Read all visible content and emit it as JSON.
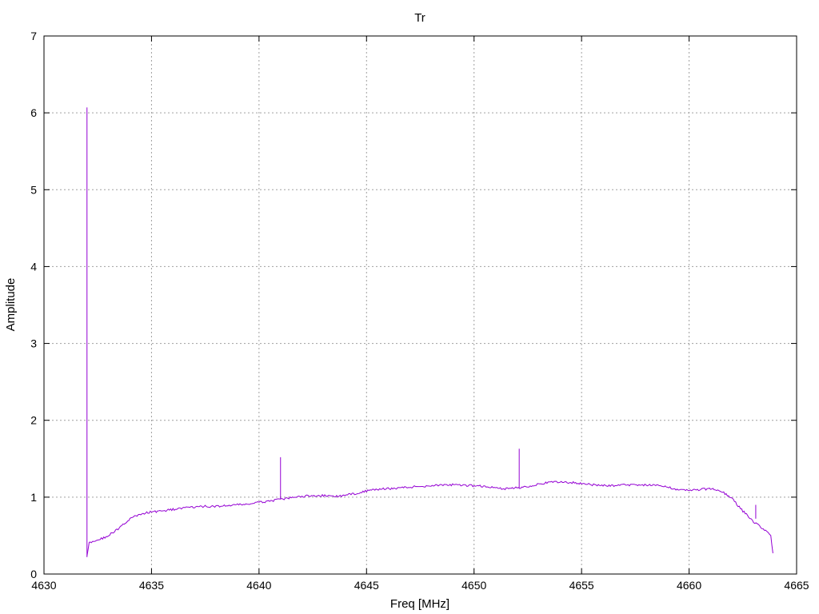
{
  "chart_data": {
    "type": "line",
    "title": "Tr",
    "xlabel": "Freq [MHz]",
    "ylabel": "Amplitude",
    "xlim": [
      4630,
      4665
    ],
    "ylim": [
      0,
      7
    ],
    "xticks": [
      4630,
      4635,
      4640,
      4645,
      4650,
      4655,
      4660,
      4665
    ],
    "yticks": [
      0,
      1,
      2,
      3,
      4,
      5,
      6,
      7
    ],
    "grid": true,
    "legend": "none",
    "series_color": "#9400d3",
    "grid_color": "#a0a0a0",
    "series": [
      {
        "x": [
          4632.0,
          4632.1,
          4632.2,
          4632.5,
          4633.0,
          4633.5,
          4634.0,
          4634.5,
          4635.0,
          4635.5,
          4636.0,
          4636.5,
          4637.0,
          4637.5,
          4638.0,
          4638.5,
          4639.0,
          4639.5,
          4640.0,
          4640.5,
          4641.0,
          4641.5,
          4642.0,
          4642.5,
          4643.0,
          4643.5,
          4644.0,
          4644.5,
          4645.0,
          4645.5,
          4646.0,
          4646.5,
          4647.0,
          4647.5,
          4648.0,
          4648.5,
          4649.0,
          4649.5,
          4650.0,
          4650.5,
          4651.0,
          4651.5,
          4652.0,
          4652.5,
          4653.0,
          4653.5,
          4654.0,
          4654.5,
          4655.0,
          4655.5,
          4656.0,
          4656.5,
          4657.0,
          4657.5,
          4658.0,
          4658.5,
          4659.0,
          4659.5,
          4660.0,
          4660.5,
          4661.0,
          4661.5,
          4662.0,
          4662.5,
          4663.0,
          4663.5,
          4663.8,
          4663.9
        ],
        "y": [
          0.25,
          0.4,
          0.42,
          0.44,
          0.5,
          0.6,
          0.72,
          0.78,
          0.81,
          0.82,
          0.84,
          0.86,
          0.87,
          0.88,
          0.88,
          0.89,
          0.9,
          0.91,
          0.93,
          0.95,
          0.97,
          0.99,
          1.01,
          1.02,
          1.02,
          1.01,
          1.02,
          1.05,
          1.08,
          1.1,
          1.11,
          1.12,
          1.13,
          1.14,
          1.15,
          1.16,
          1.16,
          1.15,
          1.15,
          1.14,
          1.12,
          1.11,
          1.12,
          1.14,
          1.17,
          1.19,
          1.2,
          1.19,
          1.18,
          1.16,
          1.15,
          1.15,
          1.16,
          1.16,
          1.16,
          1.15,
          1.13,
          1.1,
          1.09,
          1.1,
          1.11,
          1.08,
          0.98,
          0.82,
          0.68,
          0.58,
          0.5,
          0.27
        ]
      }
    ],
    "spikes": [
      {
        "x": 4632.0,
        "y_base": 0.22,
        "y_top": 6.07
      },
      {
        "x": 4641.0,
        "y_base": 0.97,
        "y_top": 1.52
      },
      {
        "x": 4652.1,
        "y_base": 1.12,
        "y_top": 1.63
      },
      {
        "x": 4663.1,
        "y_base": 0.72,
        "y_top": 0.9
      }
    ]
  }
}
